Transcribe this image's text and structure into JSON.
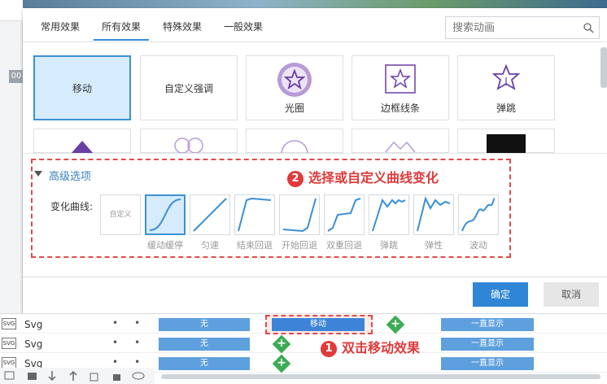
{
  "tabs": [
    "常用效果",
    "所有效果",
    "特殊效果",
    "一般效果"
  ],
  "search": {
    "placeholder": "搜索动画"
  },
  "effects_row1": [
    "移动",
    "自定义强调",
    "光圈",
    "边框线条",
    "弹跳"
  ],
  "advanced": {
    "title": "高级选项",
    "curve_label": "变化曲线:",
    "custom_label": "自定义",
    "curves": [
      "缓动缓停",
      "匀速",
      "结束回退",
      "开始回退",
      "双重回退",
      "弹跳",
      "弹性",
      "波动"
    ]
  },
  "buttons": {
    "ok": "确定",
    "cancel": "取消"
  },
  "annotations": {
    "step1_num": "1",
    "step1": "双击移动效果",
    "step2_num": "2",
    "step2": "选择或自定义曲线变化"
  },
  "timeline": {
    "rows": [
      {
        "name": "Svg",
        "track": "无",
        "effect": "移动",
        "show": "一直显示"
      },
      {
        "name": "Svg",
        "track": "无",
        "show": "一直显示"
      },
      {
        "name": "Svg",
        "track": "无",
        "show": "一直显示"
      }
    ],
    "icon_label": "SVG"
  },
  "bg": {
    "tag": "00"
  },
  "colors": {
    "accent": "#2f86d6",
    "annotation": "#e03a3a",
    "track": "#5ea0de"
  }
}
